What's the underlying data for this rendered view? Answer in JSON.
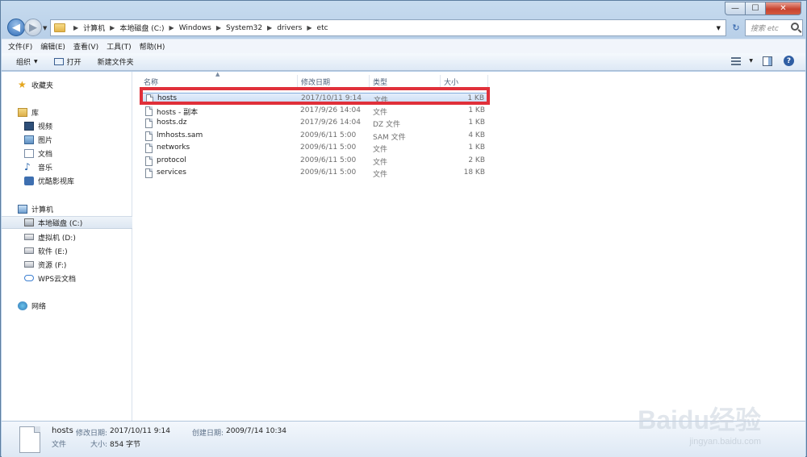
{
  "window": {
    "minimize": "—",
    "maximize": "☐",
    "close": "✕"
  },
  "nav": {
    "back": "◀",
    "forward": "▶",
    "breadcrumb": [
      "计算机",
      "本地磁盘 (C:)",
      "Windows",
      "System32",
      "drivers",
      "etc"
    ],
    "search_placeholder": "搜索 etc"
  },
  "menu": [
    "文件(F)",
    "编辑(E)",
    "查看(V)",
    "工具(T)",
    "帮助(H)"
  ],
  "toolbar": {
    "organize": "组织",
    "open": "打开",
    "new_folder": "新建文件夹"
  },
  "sidebar": {
    "favorites": "收藏夹",
    "libraries": "库",
    "lib_items": [
      "视频",
      "图片",
      "文档",
      "音乐",
      "优酷影视库"
    ],
    "computer": "计算机",
    "drives": [
      "本地磁盘 (C:)",
      "虚拟机 (D:)",
      "软件 (E:)",
      "资源 (F:)",
      "WPS云文档"
    ],
    "network": "网络"
  },
  "columns": [
    "名称",
    "修改日期",
    "类型",
    "大小"
  ],
  "files": [
    {
      "name": "hosts",
      "date": "2017/10/11 9:14",
      "type": "文件",
      "size": "1 KB"
    },
    {
      "name": "hosts - 副本",
      "date": "2017/9/26 14:04",
      "type": "文件",
      "size": "1 KB"
    },
    {
      "name": "hosts.dz",
      "date": "2017/9/26 14:04",
      "type": "DZ 文件",
      "size": "1 KB"
    },
    {
      "name": "lmhosts.sam",
      "date": "2009/6/11 5:00",
      "type": "SAM 文件",
      "size": "4 KB"
    },
    {
      "name": "networks",
      "date": "2009/6/11 5:00",
      "type": "文件",
      "size": "1 KB"
    },
    {
      "name": "protocol",
      "date": "2009/6/11 5:00",
      "type": "文件",
      "size": "2 KB"
    },
    {
      "name": "services",
      "date": "2009/6/11 5:00",
      "type": "文件",
      "size": "18 KB"
    }
  ],
  "details": {
    "name": "hosts",
    "modified_label": "修改日期:",
    "modified": "2017/10/11 9:14",
    "created_label": "创建日期:",
    "created": "2009/7/14 10:34",
    "type": "文件",
    "size_label": "大小:",
    "size": "854 字节"
  },
  "watermark": {
    "logo": "Baidu经验",
    "url": "jingyan.baidu.com"
  },
  "colors": {
    "highlight_box": "#e0303a",
    "selection": "#c9dcf4"
  }
}
